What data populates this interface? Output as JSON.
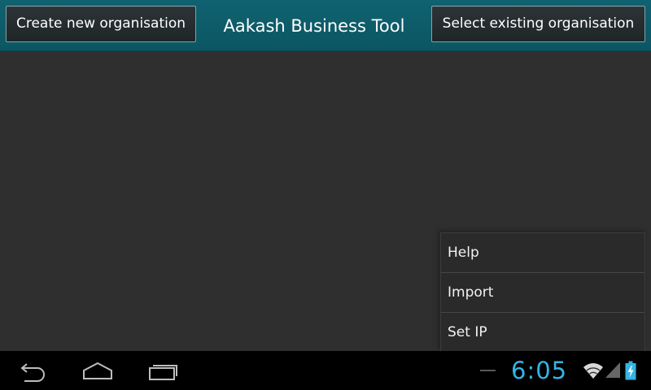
{
  "header": {
    "create_button_label": "Create new organisation",
    "app_title": "Aakash Business Tool",
    "select_button_label": "Select existing organisation"
  },
  "menu": {
    "items": [
      {
        "label": "Help"
      },
      {
        "label": "Import"
      },
      {
        "label": "Set IP"
      }
    ]
  },
  "navbar": {
    "back_icon": "back-icon",
    "home_icon": "home-icon",
    "recent_icon": "recent-apps-icon"
  },
  "status": {
    "time": "6:05",
    "clock_color": "#33b5e5",
    "wifi_icon": "wifi-icon",
    "signal_icon": "signal-icon",
    "battery_icon": "battery-charging-icon"
  },
  "colors": {
    "header_bg": "#0f6270",
    "body_bg": "#2f2f2f",
    "navbar_bg": "#000000"
  }
}
